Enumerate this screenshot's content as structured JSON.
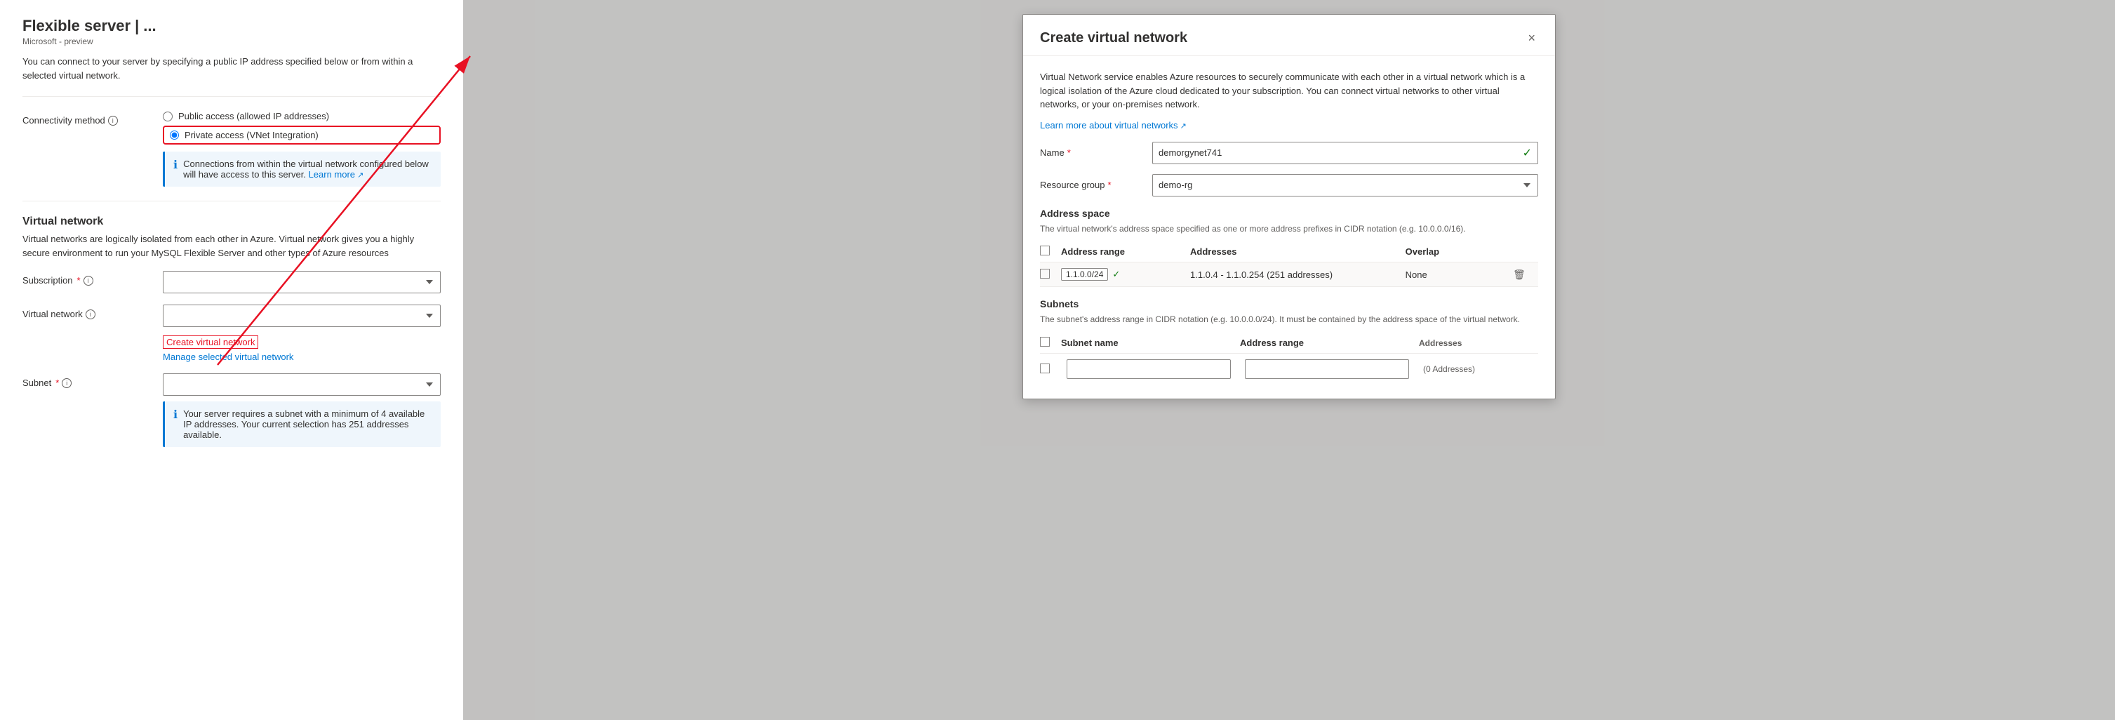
{
  "page": {
    "title": "Flexible server",
    "pipe": "|",
    "ellipsis": "...",
    "subtitle": "Microsoft - preview",
    "description": "You can connect to your server by specifying a public IP address specified below or from within a selected virtual network.",
    "connectivity": {
      "label": "Connectivity method",
      "info": "i",
      "options": {
        "public": "Public access (allowed IP addresses)",
        "private": "Private access (VNet Integration)"
      },
      "infobox_text": "Connections from within the virtual network configured below will have access to this server.",
      "infobox_link": "Learn more",
      "selected": "private"
    },
    "virtual_network": {
      "heading": "Virtual network",
      "description": "Virtual networks are logically isolated from each other in Azure. Virtual network gives you a highly secure environment to run your MySQL Flexible Server and other types of Azure resources",
      "subscription": {
        "label": "Subscription",
        "required": true,
        "info": "i",
        "value": ""
      },
      "vnet": {
        "label": "Virtual network",
        "info": "i",
        "value": ""
      },
      "create_link": "Create virtual network",
      "manage_link": "Manage selected virtual network",
      "subnet": {
        "label": "Subnet",
        "required": true,
        "info": "i",
        "value": ""
      },
      "subnet_infobox": "Your server requires a subnet with a minimum of 4 available IP addresses. Your current selection has 251 addresses available."
    }
  },
  "modal": {
    "title": "Create virtual network",
    "close": "×",
    "description": "Virtual Network service enables Azure resources to securely communicate with each other in a virtual network which is a logical isolation of the Azure cloud dedicated to your subscription. You can connect virtual networks to other virtual networks, or your on-premises network.",
    "learn_more": "Learn more about virtual networks",
    "name": {
      "label": "Name",
      "required": true,
      "value": "demorgynet741",
      "check": "✓"
    },
    "resource_group": {
      "label": "Resource group",
      "required": true,
      "value": "demo-rg"
    },
    "address_space": {
      "heading": "Address space",
      "description": "The virtual network's address space specified as one or more address prefixes in CIDR notation (e.g. 10.0.0.0/16).",
      "table_headers": {
        "check": "",
        "range": "Address range",
        "addresses": "Addresses",
        "overlap": "Overlap"
      },
      "rows": [
        {
          "check": false,
          "range": "1.1.0.0/24",
          "range_check": "✓",
          "addresses": "1.1.0.4 - 1.1.0.254 (251 addresses)",
          "overlap": "None"
        }
      ]
    },
    "subnets": {
      "heading": "Subnets",
      "description": "The subnet's address range in CIDR notation (e.g. 10.0.0.0/24). It must be contained by the address space of the virtual network.",
      "table_headers": {
        "check": "",
        "name": "Subnet name",
        "range": "Address range",
        "addresses": "Addresses"
      },
      "rows": [
        {
          "check": false,
          "name": "",
          "range": "",
          "addresses": "(0 Addresses)"
        }
      ]
    }
  },
  "arrow": {
    "description": "Red arrow from create virtual network link to modal"
  }
}
